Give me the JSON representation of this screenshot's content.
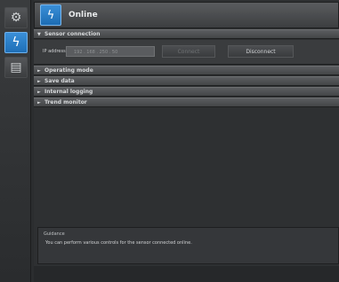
{
  "header": {
    "title": "Online"
  },
  "toolbar": {
    "items": [
      {
        "name": "gear-icon",
        "glyph": "⚙"
      },
      {
        "name": "online-icon",
        "glyph": "ϟ"
      },
      {
        "name": "sensor-icon",
        "glyph": "▤"
      }
    ]
  },
  "sections": {
    "sensor_connection": "Sensor connection",
    "operating_mode": "Operating mode",
    "save_data": "Save data",
    "internal_logging": "Internal logging",
    "trend_monitor": "Trend monitor"
  },
  "sensor": {
    "ip_label": "IP address",
    "ip_value": "192 . 168 . 250 . 50",
    "connect_label": "Connect",
    "disconnect_label": "Disconnect"
  },
  "guidance": {
    "title": "Guidance",
    "text": "You can perform various controls for the sensor connected online."
  },
  "glyphs": {
    "expanded": "▼",
    "collapsed": "►"
  }
}
